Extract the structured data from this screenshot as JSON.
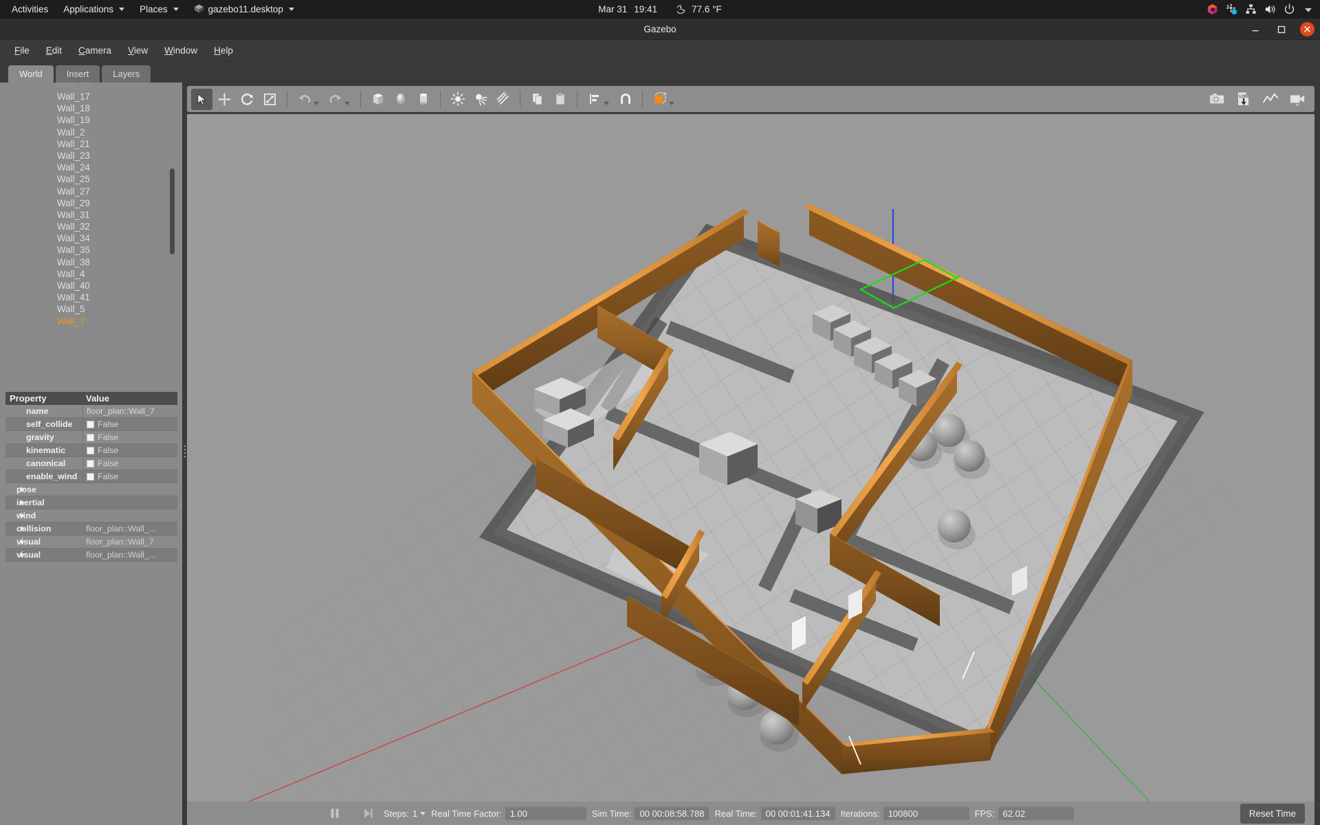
{
  "desktop": {
    "activities": "Activities",
    "applications": "Applications",
    "places": "Places",
    "app_window_label": "gazebo11.desktop",
    "app_icon": "gazebo-cube-icon",
    "clock_date": "Mar 31",
    "clock_time": "19:41",
    "weather_icon": "moon-icon",
    "weather_temp": "77.6 °F",
    "tray_icons": [
      "ubuntu-software-icon",
      "settings-sync-icon",
      "network-icon",
      "volume-icon",
      "power-icon",
      "chevron-down-icon"
    ]
  },
  "window": {
    "title": "Gazebo",
    "minimize_icon": "minimize-icon",
    "maximize_icon": "maximize-icon",
    "close_icon": "close-icon"
  },
  "menubar": {
    "items": [
      {
        "label": "File",
        "mnemonic": "F"
      },
      {
        "label": "Edit",
        "mnemonic": "E"
      },
      {
        "label": "Camera",
        "mnemonic": "C"
      },
      {
        "label": "View",
        "mnemonic": "V"
      },
      {
        "label": "Window",
        "mnemonic": "W"
      },
      {
        "label": "Help",
        "mnemonic": "H"
      }
    ]
  },
  "left_panel": {
    "tabs": [
      {
        "label": "World",
        "active": true
      },
      {
        "label": "Insert",
        "active": false
      },
      {
        "label": "Layers",
        "active": false
      }
    ],
    "tree_items": [
      {
        "label": "Wall_17",
        "selected": false
      },
      {
        "label": "Wall_18",
        "selected": false
      },
      {
        "label": "Wall_19",
        "selected": false
      },
      {
        "label": "Wall_2",
        "selected": false
      },
      {
        "label": "Wall_21",
        "selected": false
      },
      {
        "label": "Wall_23",
        "selected": false
      },
      {
        "label": "Wall_24",
        "selected": false
      },
      {
        "label": "Wall_25",
        "selected": false
      },
      {
        "label": "Wall_27",
        "selected": false
      },
      {
        "label": "Wall_29",
        "selected": false
      },
      {
        "label": "Wall_31",
        "selected": false
      },
      {
        "label": "Wall_32",
        "selected": false
      },
      {
        "label": "Wall_34",
        "selected": false
      },
      {
        "label": "Wall_35",
        "selected": false
      },
      {
        "label": "Wall_38",
        "selected": false
      },
      {
        "label": "Wall_4",
        "selected": false
      },
      {
        "label": "Wall_40",
        "selected": false
      },
      {
        "label": "Wall_41",
        "selected": false
      },
      {
        "label": "Wall_5",
        "selected": false
      },
      {
        "label": "Wall_7",
        "selected": true
      }
    ]
  },
  "properties": {
    "header": {
      "property": "Property",
      "value": "Value"
    },
    "rows": [
      {
        "key": "name",
        "value": "floor_plan::Wall_7",
        "checkbox": false,
        "expandable": false
      },
      {
        "key": "self_collide",
        "value": "False",
        "checkbox": true,
        "expandable": false
      },
      {
        "key": "gravity",
        "value": "False",
        "checkbox": true,
        "expandable": false
      },
      {
        "key": "kinematic",
        "value": "False",
        "checkbox": true,
        "expandable": false
      },
      {
        "key": "canonical",
        "value": "False",
        "checkbox": true,
        "expandable": false
      },
      {
        "key": "enable_wind",
        "value": "False",
        "checkbox": true,
        "expandable": false
      },
      {
        "key": "pose",
        "value": "",
        "checkbox": false,
        "expandable": true
      },
      {
        "key": "inertial",
        "value": "",
        "checkbox": false,
        "expandable": true
      },
      {
        "key": "wind",
        "value": "",
        "checkbox": false,
        "expandable": true
      },
      {
        "key": "collision",
        "value": "floor_plan::Wall_...",
        "checkbox": false,
        "expandable": true
      },
      {
        "key": "visual",
        "value": "floor_plan::Wall_7",
        "checkbox": false,
        "expandable": true
      },
      {
        "key": "visual",
        "value": "floor_plan::Wall_...",
        "checkbox": false,
        "expandable": true
      }
    ]
  },
  "toolbar": {
    "left_tools": [
      {
        "name": "select-mode-icon",
        "active": true
      },
      {
        "name": "translate-mode-icon",
        "active": false
      },
      {
        "name": "rotate-mode-icon",
        "active": false
      },
      {
        "name": "scale-mode-icon",
        "active": false
      },
      {
        "name": "undo-icon",
        "active": false
      },
      {
        "name": "redo-icon",
        "active": false
      },
      {
        "name": "insert-box-icon",
        "active": false
      },
      {
        "name": "insert-sphere-icon",
        "active": false
      },
      {
        "name": "insert-cylinder-icon",
        "active": false
      },
      {
        "name": "point-light-icon",
        "active": false
      },
      {
        "name": "spot-light-icon",
        "active": false
      },
      {
        "name": "directional-light-icon",
        "active": false
      },
      {
        "name": "copy-icon",
        "active": false
      },
      {
        "name": "paste-icon",
        "active": false
      },
      {
        "name": "align-icon",
        "active": false
      },
      {
        "name": "snap-icon",
        "active": false
      },
      {
        "name": "view-mode-icon",
        "active": false
      }
    ],
    "right_tools": [
      {
        "name": "screenshot-icon"
      },
      {
        "name": "log-record-icon",
        "label": "LOG"
      },
      {
        "name": "plot-icon"
      },
      {
        "name": "video-record-icon"
      }
    ]
  },
  "statusbar": {
    "pause_icon": "pause-icon",
    "step_icon": "step-forward-icon",
    "steps_label": "Steps:",
    "steps_value": "1",
    "rtf_label": "Real Time Factor:",
    "rtf_value": "1.00",
    "sim_time_label": "Sim Time:",
    "sim_time_value": "00 00:08:58.788",
    "real_time_label": "Real Time:",
    "real_time_value": "00 00:01:41.134",
    "iterations_label": "Iterations:",
    "iterations_value": "100800",
    "fps_label": "FPS:",
    "fps_value": "62.02",
    "reset_button": "Reset Time"
  },
  "scene": {
    "description": "3D floor plan with wooden walls, grid ground plane, gray spheres and boxes",
    "selection_marker": "green-selection-box",
    "axis_colors": {
      "x": "#d03a3a",
      "y": "#3fb03f",
      "z": "#2a47e0"
    },
    "ground_color": "#b8b8b8",
    "background_color": "#9a9a9a",
    "wall_highlight_color": "#f2941f",
    "sphere_count": 6,
    "sphere_color": "#9e9e9e"
  }
}
